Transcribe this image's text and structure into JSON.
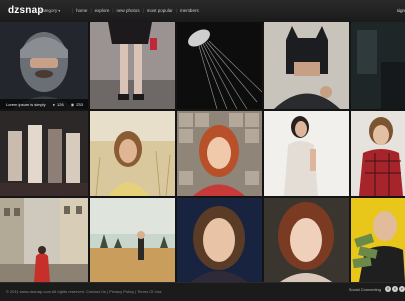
{
  "header": {
    "logo": "dzsnap",
    "category_label": "category",
    "nav": [
      "home",
      "explore",
      "new photos",
      "most popular",
      "members"
    ],
    "signup": "sign"
  },
  "featured": {
    "caption": "Lorem ipsum is simply",
    "comments": "126",
    "views": "233"
  },
  "footer": {
    "copyright": "© 2011 www.dzsnap.com All rights reserved.",
    "links": [
      "Contact Us",
      "Privacy Policy",
      "Terms Of Use"
    ],
    "social_label": "Social Connecting",
    "social_icons": [
      "f",
      "t",
      "r"
    ]
  },
  "colors": {
    "background": "#141414",
    "header": "#1f1f1f",
    "footer": "#1b1b1b"
  }
}
